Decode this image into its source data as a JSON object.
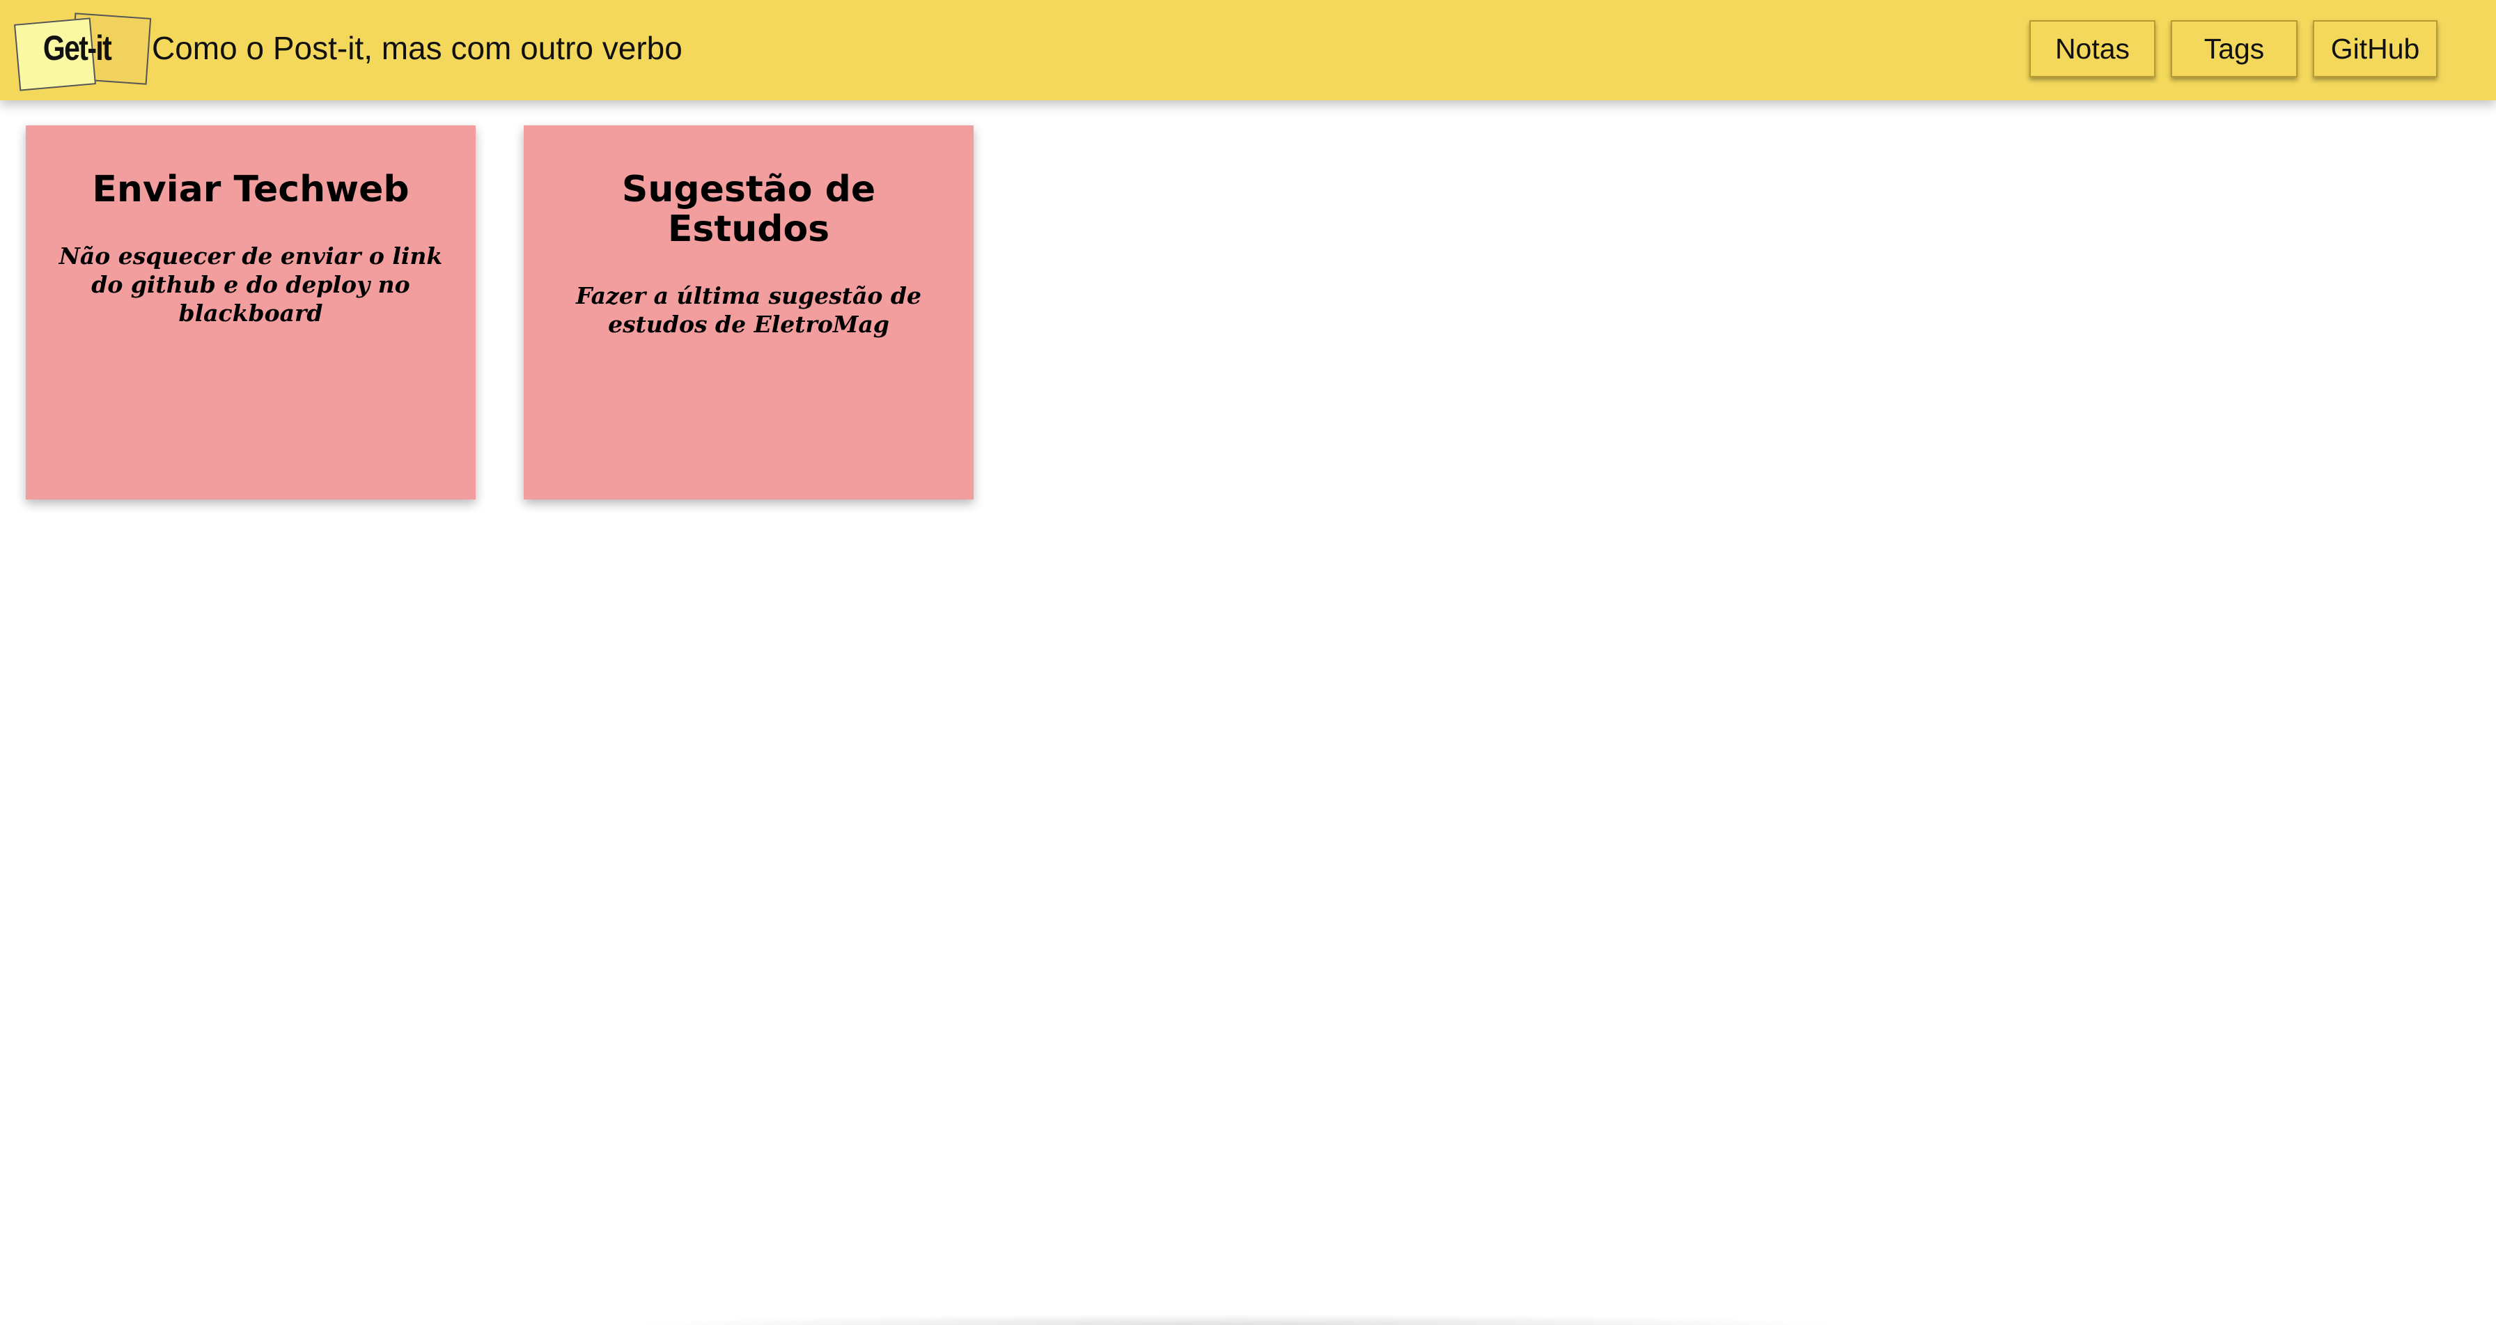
{
  "header": {
    "logo_text": "Get-it",
    "tagline": "Como o Post-it, mas com outro verbo",
    "nav": [
      {
        "label": "Notas"
      },
      {
        "label": "Tags"
      },
      {
        "label": "GitHub"
      }
    ],
    "background_color": "#f3d85c"
  },
  "notes": [
    {
      "title": "Enviar Techweb",
      "body": "Não esquecer de enviar o link do github e do deploy no blackboard",
      "color": "#f29e9e"
    },
    {
      "title": "Sugestão de Estudos",
      "body": "Fazer a última sugestão de estudos de EletroMag",
      "color": "#f29e9e"
    }
  ]
}
